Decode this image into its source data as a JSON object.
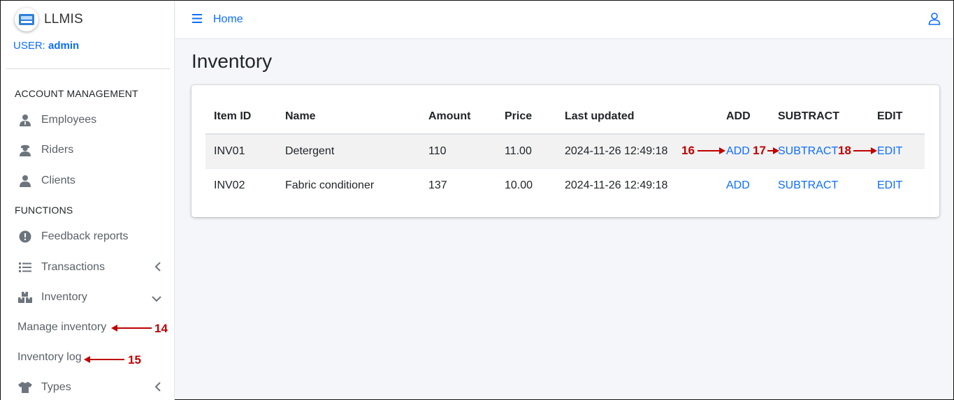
{
  "brand": {
    "name": "LLMIS"
  },
  "user": {
    "prefix": "USER:",
    "name": "admin"
  },
  "sidebar": {
    "section1": "ACCOUNT MANAGEMENT",
    "items1": [
      {
        "label": "Employees",
        "icon": "user-tie-icon"
      },
      {
        "label": "Riders",
        "icon": "rider-icon"
      },
      {
        "label": "Clients",
        "icon": "user-icon"
      }
    ],
    "section2": "FUNCTIONS",
    "items2": [
      {
        "label": "Feedback reports",
        "icon": "exclamation-circle-icon"
      },
      {
        "label": "Transactions",
        "icon": "list-icon"
      },
      {
        "label": "Inventory",
        "icon": "boxes-icon"
      }
    ],
    "subitems": [
      {
        "label": "Manage inventory"
      },
      {
        "label": "Inventory log"
      }
    ],
    "types": {
      "label": "Types",
      "icon": "shirt-icon"
    }
  },
  "topbar": {
    "home": "Home"
  },
  "page": {
    "title": "Inventory"
  },
  "table": {
    "headers": [
      "Item ID",
      "Name",
      "Amount",
      "Price",
      "Last updated",
      "ADD",
      "SUBTRACT",
      "EDIT"
    ],
    "rows": [
      {
        "id": "INV01",
        "name": "Detergent",
        "amount": "110",
        "price": "11.00",
        "updated": "2024-11-26 12:49:18",
        "add": "ADD",
        "subtract": "SUBTRACT",
        "edit": "EDIT"
      },
      {
        "id": "INV02",
        "name": "Fabric conditioner",
        "amount": "137",
        "price": "10.00",
        "updated": "2024-11-26 12:49:18",
        "add": "ADD",
        "subtract": "SUBTRACT",
        "edit": "EDIT"
      }
    ]
  },
  "annotations": {
    "a14": "14",
    "a15": "15",
    "a16": "16",
    "a17": "17",
    "a18": "18"
  },
  "colors": {
    "link": "#0d6efd",
    "annotation": "#c00000"
  }
}
